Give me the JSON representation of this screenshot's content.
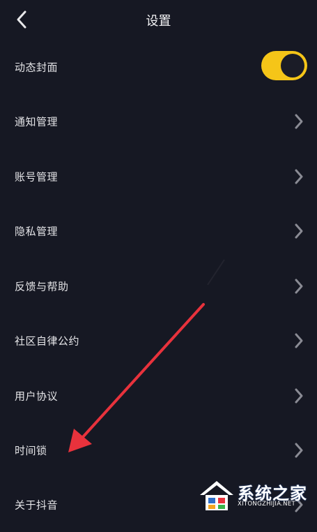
{
  "header": {
    "title": "设置",
    "back_icon": "chevron-left-icon"
  },
  "settings": [
    {
      "label": "动态封面",
      "control": "toggle",
      "toggle_on": true
    },
    {
      "label": "通知管理",
      "control": "chevron"
    },
    {
      "label": "账号管理",
      "control": "chevron"
    },
    {
      "label": "隐私管理",
      "control": "chevron"
    },
    {
      "label": "反馈与帮助",
      "control": "chevron"
    },
    {
      "label": "社区自律公约",
      "control": "chevron"
    },
    {
      "label": "用户协议",
      "control": "chevron"
    },
    {
      "label": "时间锁",
      "control": "chevron"
    },
    {
      "label": "关于抖音",
      "control": "chevron"
    }
  ],
  "watermark": {
    "text": "系统之家",
    "url": "XITONGZHIJIA.NET"
  },
  "colors": {
    "background": "#161823",
    "toggle_on": "#f5c518",
    "annotation_arrow": "#e8323c",
    "chevron": "#8a8b94"
  }
}
